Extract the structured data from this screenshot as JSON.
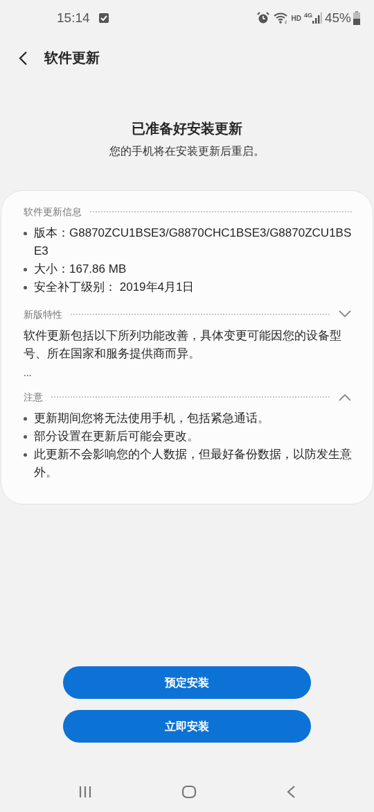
{
  "status_bar": {
    "time": "15:14",
    "network": "HD",
    "signal_type": "4G",
    "battery": "45%"
  },
  "header": {
    "title": "软件更新"
  },
  "headline": {
    "title": "已准备好安装更新",
    "subtitle": "您的手机将在安装更新后重启。"
  },
  "sections": [
    {
      "kind": "list",
      "title": "软件更新信息",
      "items": [
        "版本：G8870ZCU1BSE3/G8870CHC1BSE3/G8870ZCU1BSE3",
        "大小：167.86 MB",
        "安全补丁级别： 2019年4月1日"
      ]
    },
    {
      "kind": "paragraph",
      "title": "新版特性",
      "expanded": false,
      "text": "软件更新包括以下所列功能改善，具体变更可能因您的设备型号、所在国家和服务提供商而异。",
      "more": "..."
    },
    {
      "kind": "list",
      "title": "注意",
      "expanded": true,
      "items": [
        "更新期间您将无法使用手机，包括紧急通话。",
        "部分设置在更新后可能会更改。",
        "此更新不会影响您的个人数据，但最好备份数据，以防发生意外。"
      ]
    }
  ],
  "buttons": [
    "预定安装",
    "立即安装"
  ]
}
